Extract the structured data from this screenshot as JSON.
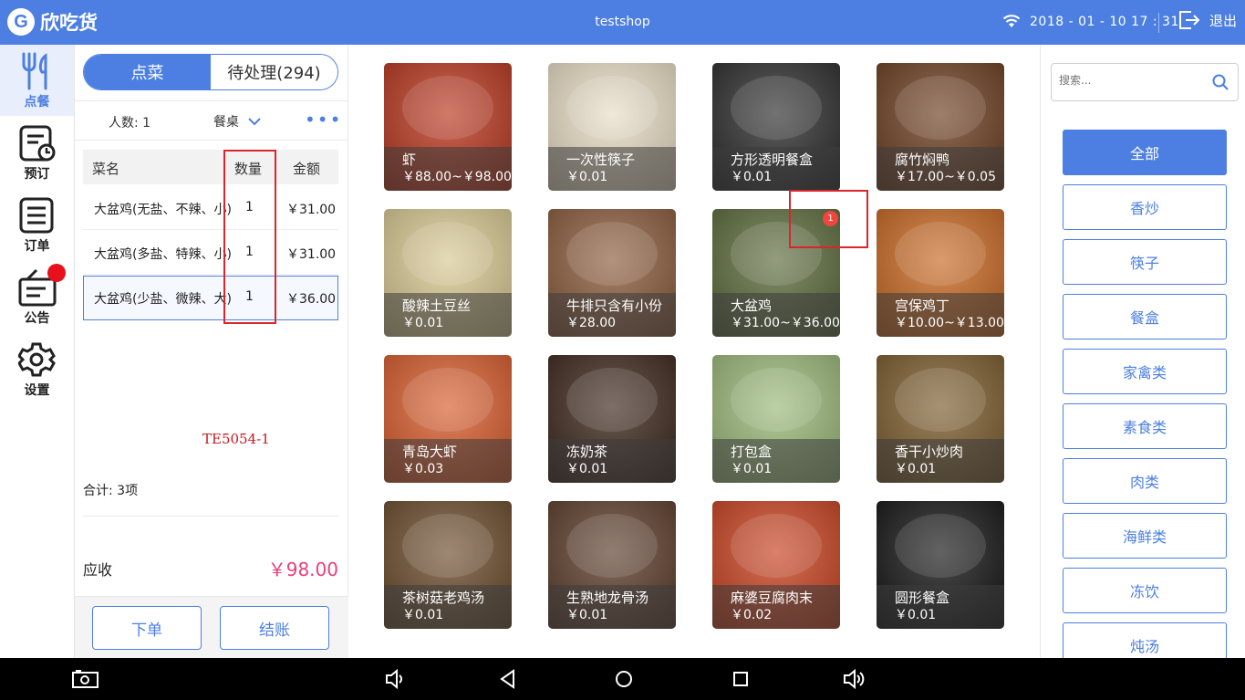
{
  "topbar": {
    "logo_mark": "G",
    "app_name": "欣吃货",
    "shop_name": "testshop",
    "datetime": "2018 - 01 - 10  17 : 31",
    "logout_label": "退出"
  },
  "sidenav": {
    "items": [
      {
        "label": "点餐",
        "icon": "fork-knife-icon"
      },
      {
        "label": "预订",
        "icon": "reservation-icon"
      },
      {
        "label": "订单",
        "icon": "order-list-icon"
      },
      {
        "label": "公告",
        "icon": "notice-icon"
      },
      {
        "label": "设置",
        "icon": "gear-icon"
      }
    ]
  },
  "order": {
    "tabs": {
      "order": "点菜",
      "pending": "待处理(294)"
    },
    "people": "人数: 1",
    "table": "餐桌",
    "more": "•••",
    "headers": {
      "name": "菜名",
      "qty": "数量",
      "amount": "金额"
    },
    "rows": [
      {
        "name": "大盆鸡(无盐、不辣、小)",
        "qty": "1",
        "amount": "￥31.00"
      },
      {
        "name": "大盆鸡(多盐、特辣、小)",
        "qty": "1",
        "amount": "￥31.00"
      },
      {
        "name": "大盆鸡(少盐、微辣、大)",
        "qty": "1",
        "amount": "￥36.00"
      }
    ],
    "watermark": "TE5054-1",
    "total": "合计:  3项",
    "receivable_label": "应收",
    "receivable_value": "￥98.00",
    "submit": "下单",
    "checkout": "结账"
  },
  "dishes": [
    {
      "name": "虾",
      "price": "￥88.00~￥98.00",
      "bg": "#b8341c"
    },
    {
      "name": "一次性筷子",
      "price": "￥0.01",
      "bg": "#e8dcc4"
    },
    {
      "name": "方形透明餐盒",
      "price": "￥0.01",
      "bg": "#2a2a2a"
    },
    {
      "name": "腐竹焖鸭",
      "price": "￥17.00~￥0.05",
      "bg": "#6b3c1e"
    },
    {
      "name": "酸辣土豆丝",
      "price": "￥0.01",
      "bg": "#d8c890"
    },
    {
      "name": "牛排只含有小份",
      "price": "￥28.00",
      "bg": "#8a5a3a"
    },
    {
      "name": "大盆鸡",
      "price": "￥31.00~￥36.00",
      "bg": "#5a6a3a",
      "count": "1"
    },
    {
      "name": "宫保鸡丁",
      "price": "￥10.00~￥13.00",
      "bg": "#c8661e"
    },
    {
      "name": "青岛大虾",
      "price": "￥0.03",
      "bg": "#d85a2a"
    },
    {
      "name": "冻奶茶",
      "price": "￥0.01",
      "bg": "#3a2418"
    },
    {
      "name": "打包盒",
      "price": "￥0.01",
      "bg": "#9ab878"
    },
    {
      "name": "香干小炒肉",
      "price": "￥0.01",
      "bg": "#7a5a2a"
    },
    {
      "name": "茶树菇老鸡汤",
      "price": "￥0.01",
      "bg": "#6a4a2a"
    },
    {
      "name": "生熟地龙骨汤",
      "price": "￥0.01",
      "bg": "#5a3a28"
    },
    {
      "name": "麻婆豆腐肉末",
      "price": "￥0.02",
      "bg": "#c8401e"
    },
    {
      "name": "圆形餐盒",
      "price": "￥0.01",
      "bg": "#111111"
    }
  ],
  "categories": {
    "search_placeholder": "搜索...",
    "items": [
      "全部",
      "香炒",
      "筷子",
      "餐盒",
      "家禽类",
      "素食类",
      "肉类",
      "海鲜类",
      "冻饮",
      "炖汤"
    ]
  },
  "colors": {
    "primary": "#4c7fe1",
    "price_pink": "#e9407a",
    "alert_red": "#e8101a"
  }
}
